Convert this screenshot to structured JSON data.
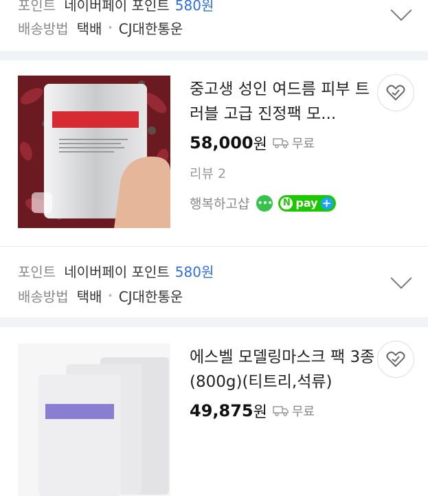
{
  "top_info": {
    "point_label": "포인트",
    "point_name": "네이버페이 포인트",
    "point_value": "580원",
    "shipping_label": "배송방법",
    "shipping_method": "택배",
    "courier": "CJ대한통운"
  },
  "products": [
    {
      "title": "중고생 성인 여드름 피부 트러블 고급 진정팩 모...",
      "price": "58,000",
      "currency": "원",
      "shipping": "무료",
      "review": "리뷰 2",
      "seller": "행복하고샵",
      "talk_icon": "chat-bubble-icon",
      "npay_n": "N",
      "npay_label": "pay",
      "npay_plus": "+",
      "info": {
        "point_label": "포인트",
        "point_name": "네이버페이 포인트",
        "point_value": "580원",
        "shipping_label": "배송방법",
        "shipping_method": "택배",
        "courier": "CJ대한통운"
      }
    },
    {
      "title": "에스벨 모델링마스크 팩 3종 (800g)(티트리,석류)",
      "price": "49,875",
      "currency": "원",
      "shipping": "무료"
    }
  ],
  "colors": {
    "accent": "#2f6ee0",
    "npay_green": "#1ec800",
    "talk_green": "#37c24c",
    "separator": "#f2f3f6"
  }
}
